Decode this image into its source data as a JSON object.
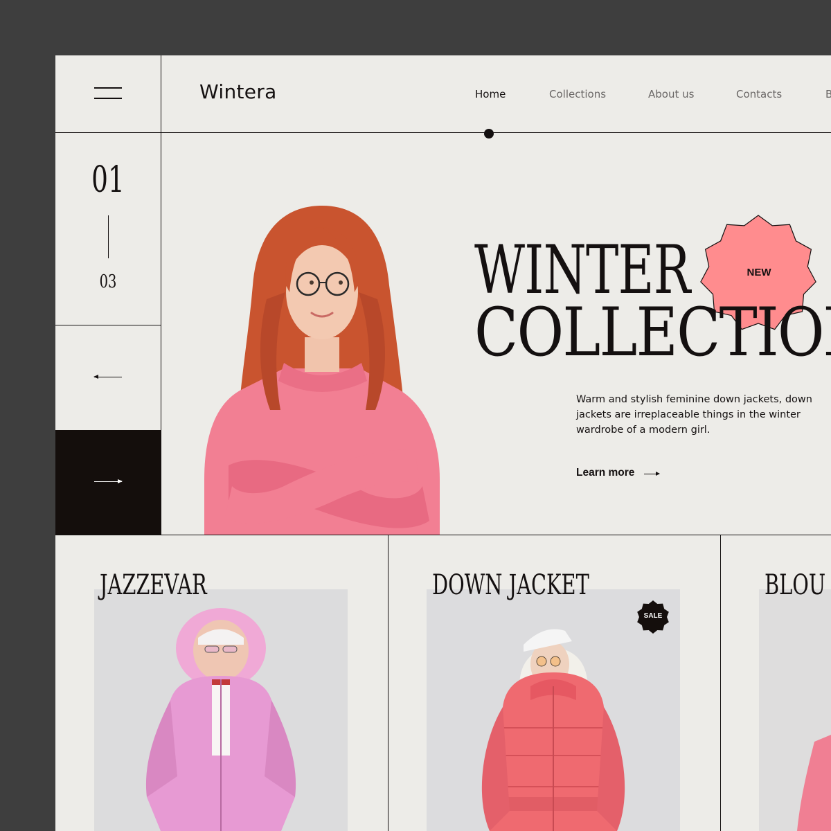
{
  "header": {
    "logo": "Wintera",
    "nav": [
      {
        "label": "Home",
        "active": true
      },
      {
        "label": "Collections",
        "active": false
      },
      {
        "label": "About us",
        "active": false
      },
      {
        "label": "Contacts",
        "active": false
      },
      {
        "label": "B",
        "active": false
      }
    ]
  },
  "slider": {
    "current": "01",
    "total": "03"
  },
  "hero": {
    "title_line1": "WINTER",
    "title_line2": "COLLECTION",
    "badge": "NEW",
    "description": "Warm and stylish feminine down jackets, down jackets are irreplaceable things in the winter wardrobe of a modern girl.",
    "cta": "Learn more"
  },
  "products": [
    {
      "title": "JAZZEVAR",
      "badge": ""
    },
    {
      "title": "DOWN JACKET",
      "badge": "SALE"
    },
    {
      "title": "BLOU",
      "badge": ""
    }
  ],
  "colors": {
    "page_bg": "#edece8",
    "outer_bg": "#3e3e3e",
    "ink": "#141010",
    "accent_pink": "#ff8c8e",
    "sweater_pink": "#f27f93",
    "hair": "#c9542f"
  },
  "icons": {
    "menu": "hamburger-icon",
    "prev": "arrow-left-icon",
    "next": "arrow-right-icon",
    "cta": "arrow-right-icon"
  }
}
